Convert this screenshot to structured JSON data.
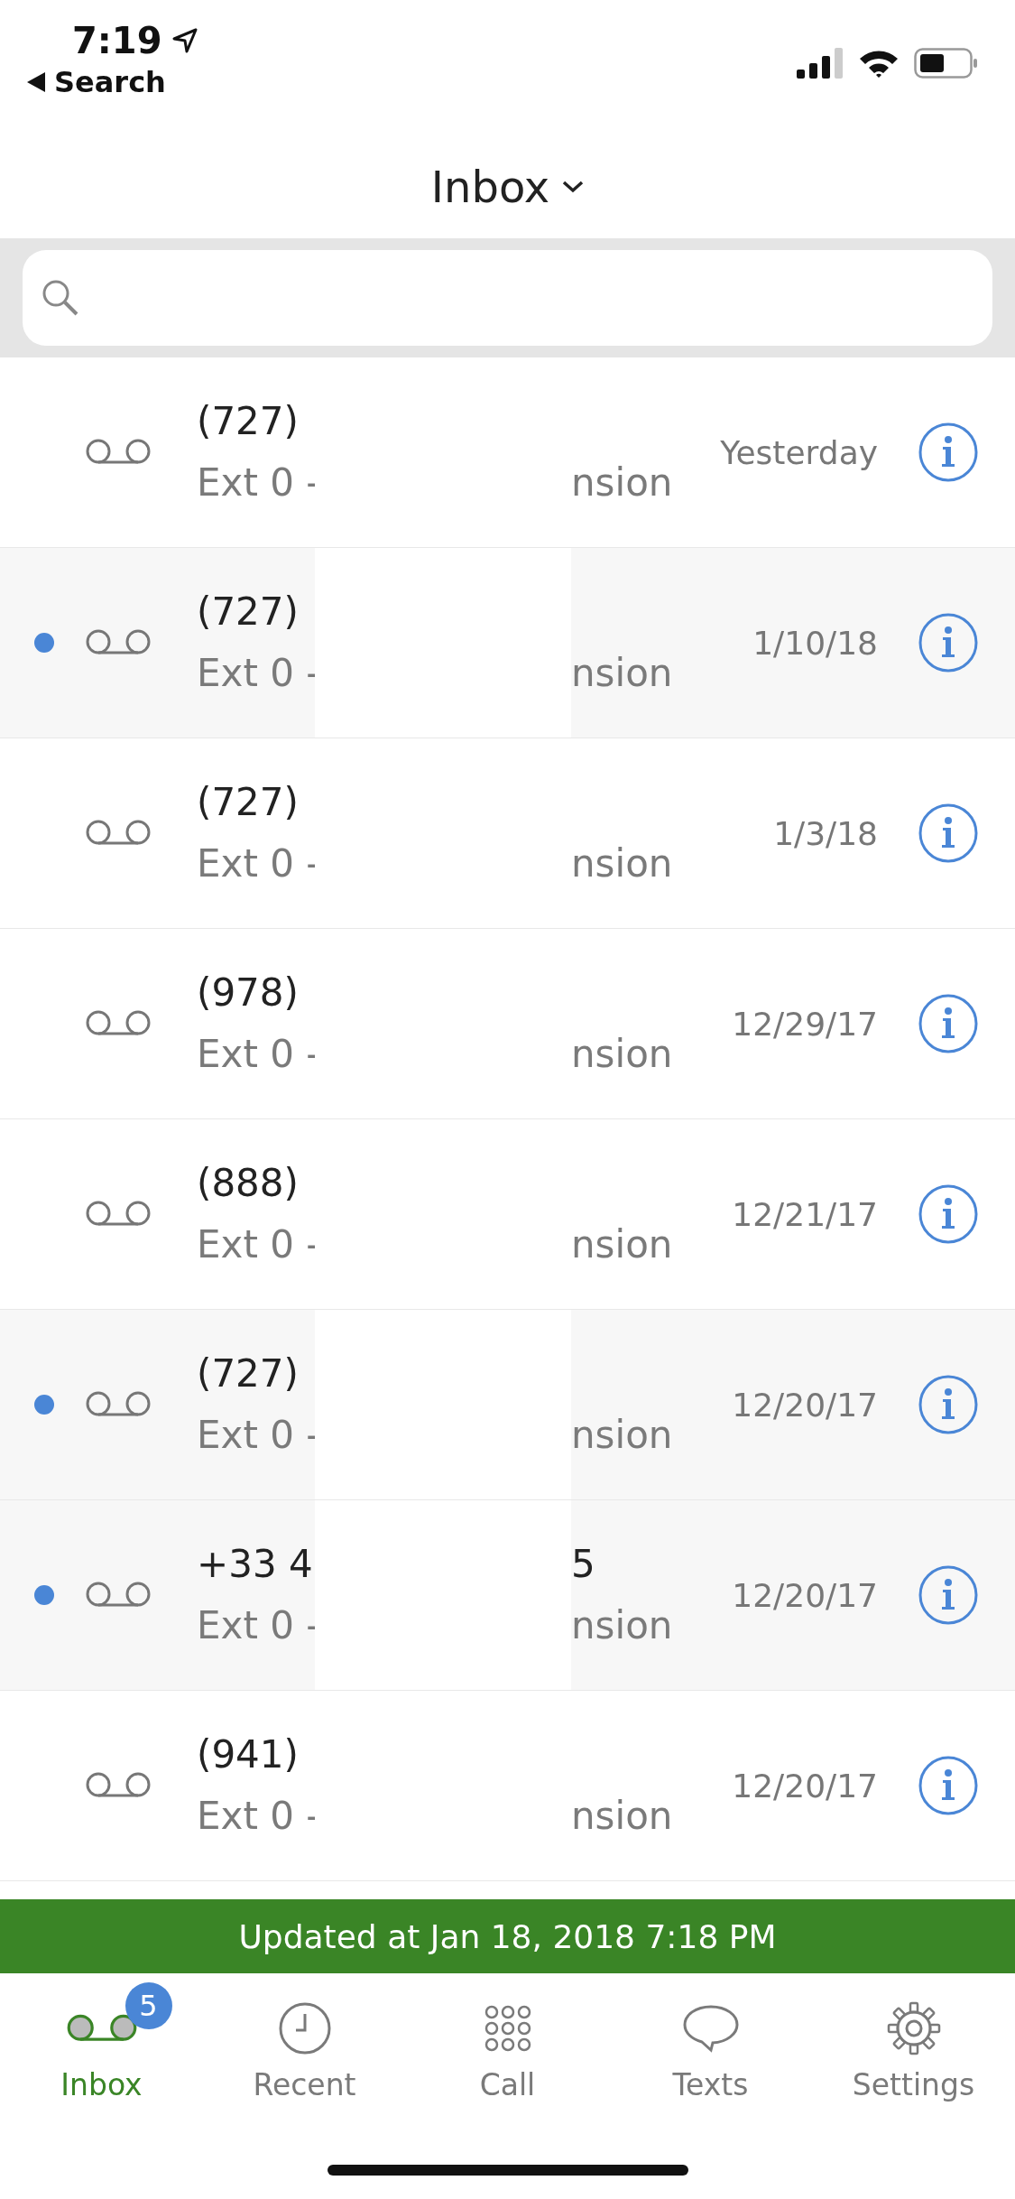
{
  "status_bar": {
    "time": "7:19",
    "back_label": "Search"
  },
  "header": {
    "title": "Inbox"
  },
  "messages": [
    {
      "number_start": "(727)",
      "ext_start": "Ext 0 -",
      "ext_end": "nsion",
      "date": "Yesterday",
      "unread": false
    },
    {
      "number_start": "(727)",
      "ext_start": "Ext 0 -",
      "ext_end": "nsion",
      "date": "1/10/18",
      "unread": true
    },
    {
      "number_start": "(727)",
      "ext_start": "Ext 0 -",
      "ext_end": "nsion",
      "date": "1/3/18",
      "unread": false
    },
    {
      "number_start": "(978)",
      "ext_start": "Ext 0 -",
      "ext_end": "nsion",
      "date": "12/29/17",
      "unread": false
    },
    {
      "number_start": "(888)",
      "ext_start": "Ext 0 -",
      "ext_end": "nsion",
      "date": "12/21/17",
      "unread": false
    },
    {
      "number_start": "(727)",
      "ext_start": "Ext 0 -",
      "ext_end": "nsion",
      "date": "12/20/17",
      "unread": true
    },
    {
      "number_start": "+33 4",
      "number_end": "5",
      "ext_start": "Ext 0 -",
      "ext_end": "nsion",
      "date": "12/20/17",
      "unread": true
    },
    {
      "number_start": "(941)",
      "ext_start": "Ext 0 -",
      "ext_end": "nsion",
      "date": "12/20/17",
      "unread": false
    }
  ],
  "banner": {
    "text": "Updated at Jan 18, 2018 7:18 PM"
  },
  "tabs": [
    {
      "kind": "voicemail",
      "label": "Inbox",
      "selected": true,
      "badge": "5"
    },
    {
      "kind": "clock",
      "label": "Recent",
      "selected": false
    },
    {
      "kind": "keypad",
      "label": "Call",
      "selected": false
    },
    {
      "kind": "chat",
      "label": "Texts",
      "selected": false
    },
    {
      "kind": "gear",
      "label": "Settings",
      "selected": false
    }
  ]
}
